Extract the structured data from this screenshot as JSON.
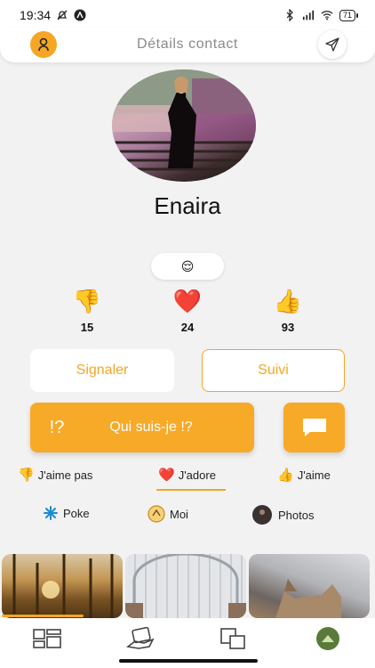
{
  "status_bar": {
    "time": "19:34",
    "battery": "71"
  },
  "header": {
    "title": "Détails contact"
  },
  "profile": {
    "name": "Enaira",
    "mood": "😌"
  },
  "stats": [
    {
      "icon": "👎",
      "count": "15"
    },
    {
      "icon": "❤️",
      "count": "24"
    },
    {
      "icon": "👍",
      "count": "93"
    }
  ],
  "actions": {
    "report_label": "Signaler",
    "follow_label": "Suivi",
    "who_am_i_label": "Qui suis-je !?",
    "who_am_i_icon": "!?"
  },
  "tabs": [
    {
      "icon": "👎",
      "label": "J'aime pas"
    },
    {
      "icon": "❤️",
      "label": "J'adore"
    },
    {
      "icon": "👍",
      "label": "J'aime"
    }
  ],
  "links": {
    "poke": "Poke",
    "moi": "Moi",
    "photos": "Photos"
  },
  "colors": {
    "accent": "#f5a623",
    "background": "#f2f2f2"
  }
}
